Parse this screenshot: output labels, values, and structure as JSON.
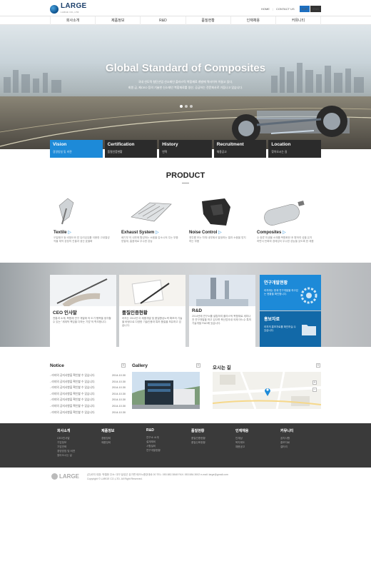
{
  "header": {
    "brand": "LARGE",
    "brand_sub": "LARGE CO.,LTD",
    "links": [
      "HOME",
      "CONTACT US"
    ],
    "lang": [
      {
        "label": "KOR",
        "color": "#1d6fc0"
      },
      {
        "label": "ENG",
        "color": "#333333"
      }
    ]
  },
  "gnb": [
    "회사소개",
    "제품정보",
    "R&D",
    "품질현황",
    "인재채용",
    "커뮤니티"
  ],
  "hero": {
    "title": "Global Standard of Composites",
    "line1": "국내 선도적 첨단산업 선소재인 플라스틱 복합재료 개발에 역사이어 이끌고 있다,",
    "line2": "회원 금, 제CEO 등의 기술한 신소재인 복합재료를 생산, 공급하는 전문회사로 거듭나고 있습니다."
  },
  "tabs": [
    {
      "title": "Vision",
      "sub": "경영방침 및 비젼",
      "active": true
    },
    {
      "title": "Certification",
      "sub": "품질인증현황",
      "active": false
    },
    {
      "title": "History",
      "sub": "연혁",
      "active": false
    },
    {
      "title": "Recruitment",
      "sub": "채용공고",
      "active": false
    },
    {
      "title": "Location",
      "sub": "찾아오시는 길",
      "active": false
    }
  ],
  "product": {
    "title": "PRODUCT",
    "items": [
      {
        "name": "Textile",
        "arrow": "▷",
        "desc": "오일탱크 등 비정도와 방 유리섬유를 이용한 고내열성 직물 제작 공정의 진을과 생산 효율화"
      },
      {
        "name": "Exhaust System",
        "arrow": "▷",
        "desc": "배기부 의 내부에 활성하는 소음을 감소시켜 주는 부품 방열재, 흡음재로 우수한 성능"
      },
      {
        "name": "Noise Control",
        "arrow": "▷",
        "desc": "엔진룸 모는 차체 내부에서 발생하는 열과 소음을 방지하는 부품"
      },
      {
        "name": "Composites",
        "arrow": "▷",
        "desc": "수 중류 미생물 소재를 복합화한 후 원하여 성을 유지하면서 탄화와 경제성이 우수한 성능을 갖도록 한 제품"
      }
    ]
  },
  "cards": [
    {
      "title": "CEO 인사말",
      "desc": "전통과 소재, 복합재 연구 개발에 의 도가 행복을 생각할 수 있는 \"세계적 책임을 다하는 기업\"의 학조합니다."
    },
    {
      "title": "품질인증현황",
      "desc": "라지는 2012년 이 제품개발 및 품질향상노력 확보의 기술을 바탕으로 다양한 기술인증과 특허 품질을 보유하고 있습니다."
    },
    {
      "title": "R&D",
      "desc": "2014년에 연구소를 설립하여 플라스틱 복합재료 세미나 전 연구개발을 하고 있으며 축산업국내 국제 어느수 특히 기술개발 R&D에 있습니다."
    }
  ],
  "blueboxes": [
    {
      "title": "연구개발현황",
      "desc": "라지에는 현재 연구개발을 하고있는 현황을 확인합니다."
    },
    {
      "title": "홍보자료",
      "desc": "라지의 홍보자료를 확인하실 수 있습니다."
    }
  ],
  "notice": {
    "title": "Notice",
    "plus": "+",
    "items": [
      {
        "text": "- 라지의 공지사항을 확인할 수 있습니다.",
        "date": "2014.10.30"
      },
      {
        "text": "- 라지의 공지사항을 확인할 수 있습니다.",
        "date": "2014.10.30"
      },
      {
        "text": "- 라지의 공지사항을 확인할 수 있습니다.",
        "date": "2014.10.30"
      },
      {
        "text": "- 라지의 공지사항을 확인할 수 있습니다.",
        "date": "2014.10.30"
      },
      {
        "text": "- 라지의 공지사항을 확인할 수 있습니다.",
        "date": "2014.10.30"
      },
      {
        "text": "- 라지의 공지사항을 확인할 수 있습니다.",
        "date": "2014.10.30"
      },
      {
        "text": "- 라지의 공지사항을 확인할 수 있습니다.",
        "date": "2014.10.30"
      }
    ]
  },
  "gallery": {
    "title": "Gallery",
    "plus": "+"
  },
  "map": {
    "title": "오시는 길",
    "plus": "+",
    "zoom_in": "+",
    "zoom_out": "−"
  },
  "footer": {
    "cols": [
      {
        "title": "회사소개",
        "items": [
          "CEO인사말",
          "기업정보",
          "기업연혁",
          "경영방침 및 비젼",
          "찾아오시는 길"
        ]
      },
      {
        "title": "제품정보",
        "items": [
          "경량장비",
          "제품장비"
        ]
      },
      {
        "title": "R&D",
        "items": [
          "연구소 소개",
          "설계제비",
          "시험설비",
          "연구개발현황"
        ]
      },
      {
        "title": "품질현황",
        "items": [
          "품질인증현황",
          "품질신뢰현황"
        ]
      },
      {
        "title": "인재채용",
        "items": [
          "인재상",
          "복지제도",
          "채용공고"
        ]
      },
      {
        "title": "커뮤니티",
        "items": [
          "공지사항",
          "홍보자료",
          "갤러리"
        ]
      }
    ],
    "address": "(주)라지 대표: 박철현 주소: 대구 달성군 유가면 테크노중앙대로 00 TEL: 053.582.3848 FAX: 053.584.3002 e-mail: large@gmail.com",
    "copyright": "Copyright © LARGE CO.,LTD. All Right Reserved."
  }
}
